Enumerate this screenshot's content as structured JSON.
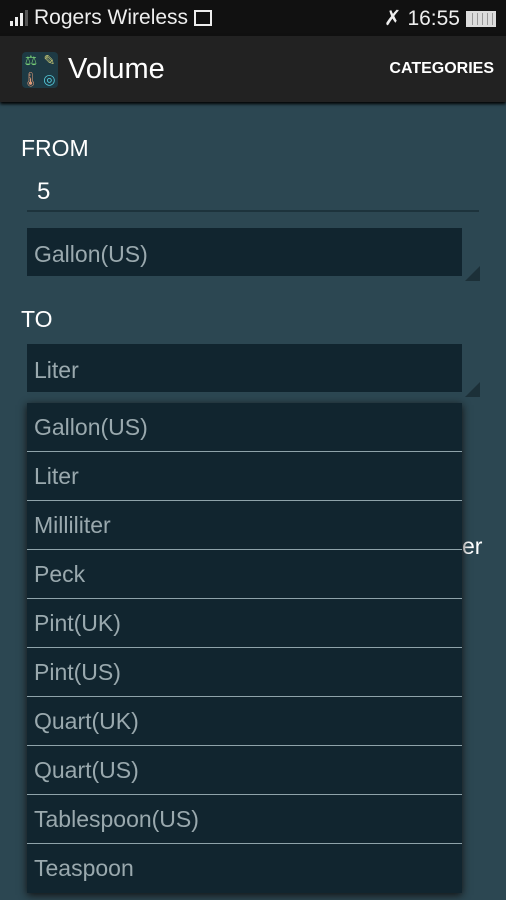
{
  "status": {
    "carrier": "Rogers Wireless",
    "time": "16:55"
  },
  "action_bar": {
    "title": "Volume",
    "categories": "CATEGORIES"
  },
  "from": {
    "label": "FROM",
    "value": "5",
    "unit": "Gallon(US)"
  },
  "to": {
    "label": "TO",
    "unit": "Liter"
  },
  "result_partial": "er",
  "dropdown": {
    "options": [
      "Gallon(US)",
      "Liter",
      "Milliliter",
      "Peck",
      "Pint(UK)",
      "Pint(US)",
      "Quart(UK)",
      "Quart(US)",
      "Tablespoon(US)",
      "Teaspoon"
    ]
  }
}
